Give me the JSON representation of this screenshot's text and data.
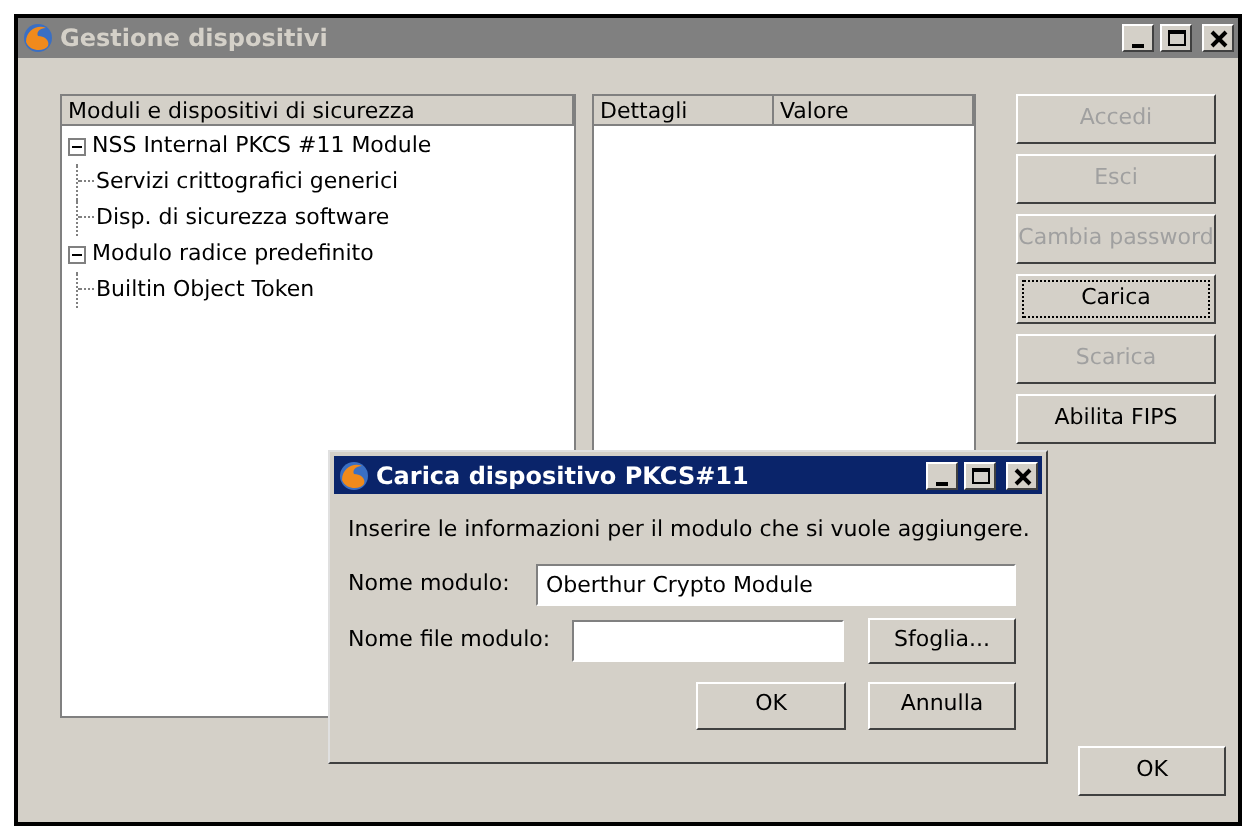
{
  "window": {
    "title": "Gestione dispositivi",
    "active": false
  },
  "tree": {
    "header": "Moduli e dispositivi di sicurezza",
    "items": [
      {
        "label": "NSS Internal PKCS #11 Module",
        "expanded": true,
        "children": [
          {
            "label": "Servizi crittografici generici"
          },
          {
            "label": "Disp. di sicurezza software"
          }
        ]
      },
      {
        "label": "Modulo radice predefinito",
        "expanded": true,
        "children": [
          {
            "label": "Builtin Object Token"
          }
        ]
      }
    ]
  },
  "details": {
    "columns": [
      "Dettagli",
      "Valore"
    ]
  },
  "buttons": [
    {
      "label": "Accedi",
      "disabled": true,
      "focused": false
    },
    {
      "label": "Esci",
      "disabled": true,
      "focused": false
    },
    {
      "label": "Cambia password",
      "disabled": true,
      "focused": false
    },
    {
      "label": "Carica",
      "disabled": false,
      "focused": true
    },
    {
      "label": "Scarica",
      "disabled": true,
      "focused": false
    },
    {
      "label": "Abilita FIPS",
      "disabled": false,
      "focused": false
    }
  ],
  "ok_button": "OK",
  "dialog": {
    "title": "Carica dispositivo PKCS#11",
    "active": true,
    "message": "Inserire le informazioni per il modulo che si vuole aggiungere.",
    "module_name": {
      "label": "Nome modulo:",
      "value": "Oberthur Crypto Module"
    },
    "module_file": {
      "label": "Nome file modulo:"
    },
    "browse_button": "Sfoglia...",
    "ok_button": "OK",
    "cancel_button": "Annulla"
  }
}
